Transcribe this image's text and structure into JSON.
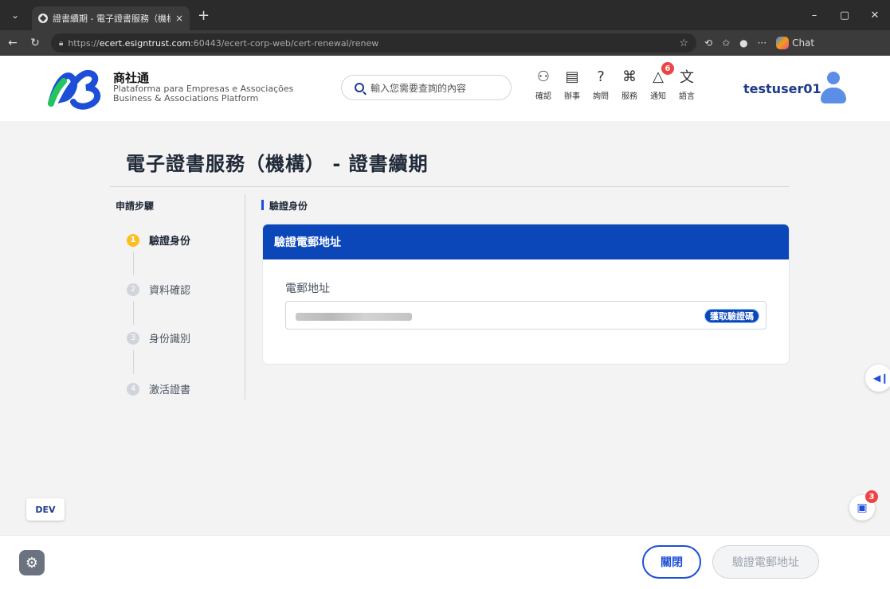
{
  "browser": {
    "tab_title": "證書續期 - 電子證書服務（機構）",
    "tab_close": "×",
    "new_tab": "+",
    "url_prefix": "https://",
    "url_host": "ecert.esigntrust.com",
    "url_path": ":60443/ecert-corp-web/cert-renewal/renew",
    "chat_label": "Chat"
  },
  "header": {
    "logo_cn": "商社通",
    "logo_pt": "Plataforma para Empresas e Associações",
    "logo_en": "Business & Associations Platform",
    "search_placeholder": "輸入您需要查詢的內容",
    "icons": [
      {
        "label": "確認",
        "icon": "handshake-icon",
        "glyph": "⚇"
      },
      {
        "label": "辦事",
        "icon": "briefcase-icon",
        "glyph": "▤"
      },
      {
        "label": "詢問",
        "icon": "question-icon",
        "glyph": "?"
      },
      {
        "label": "服務",
        "icon": "grid-icon",
        "glyph": "⌘"
      },
      {
        "label": "通知",
        "icon": "bell-icon",
        "glyph": "△"
      },
      {
        "label": "語言",
        "icon": "translate-icon",
        "glyph": "文"
      }
    ],
    "notification_count": "6",
    "username": "testuser01"
  },
  "page": {
    "title": "電子證書服務（機構） - 證書續期",
    "steps_heading": "申請步驟",
    "steps": [
      {
        "num": "1",
        "label": "驗證身份",
        "active": true
      },
      {
        "num": "2",
        "label": "資料確認",
        "active": false
      },
      {
        "num": "3",
        "label": "身份識別",
        "active": false
      },
      {
        "num": "4",
        "label": "激活證書",
        "active": false
      }
    ],
    "section_label": "驗證身份",
    "card_title": "驗證電郵地址",
    "email_label": "電郵地址",
    "get_code_label": "獲取驗證碼"
  },
  "floating": {
    "dev_label": "DEV",
    "help_badge": "3"
  },
  "footer": {
    "close_label": "關閉",
    "verify_label": "驗證電郵地址"
  },
  "colors": {
    "primary": "#0b47b8",
    "accent": "#1d4ed8",
    "active_step": "#fbbf24",
    "badge": "#ef4444"
  }
}
